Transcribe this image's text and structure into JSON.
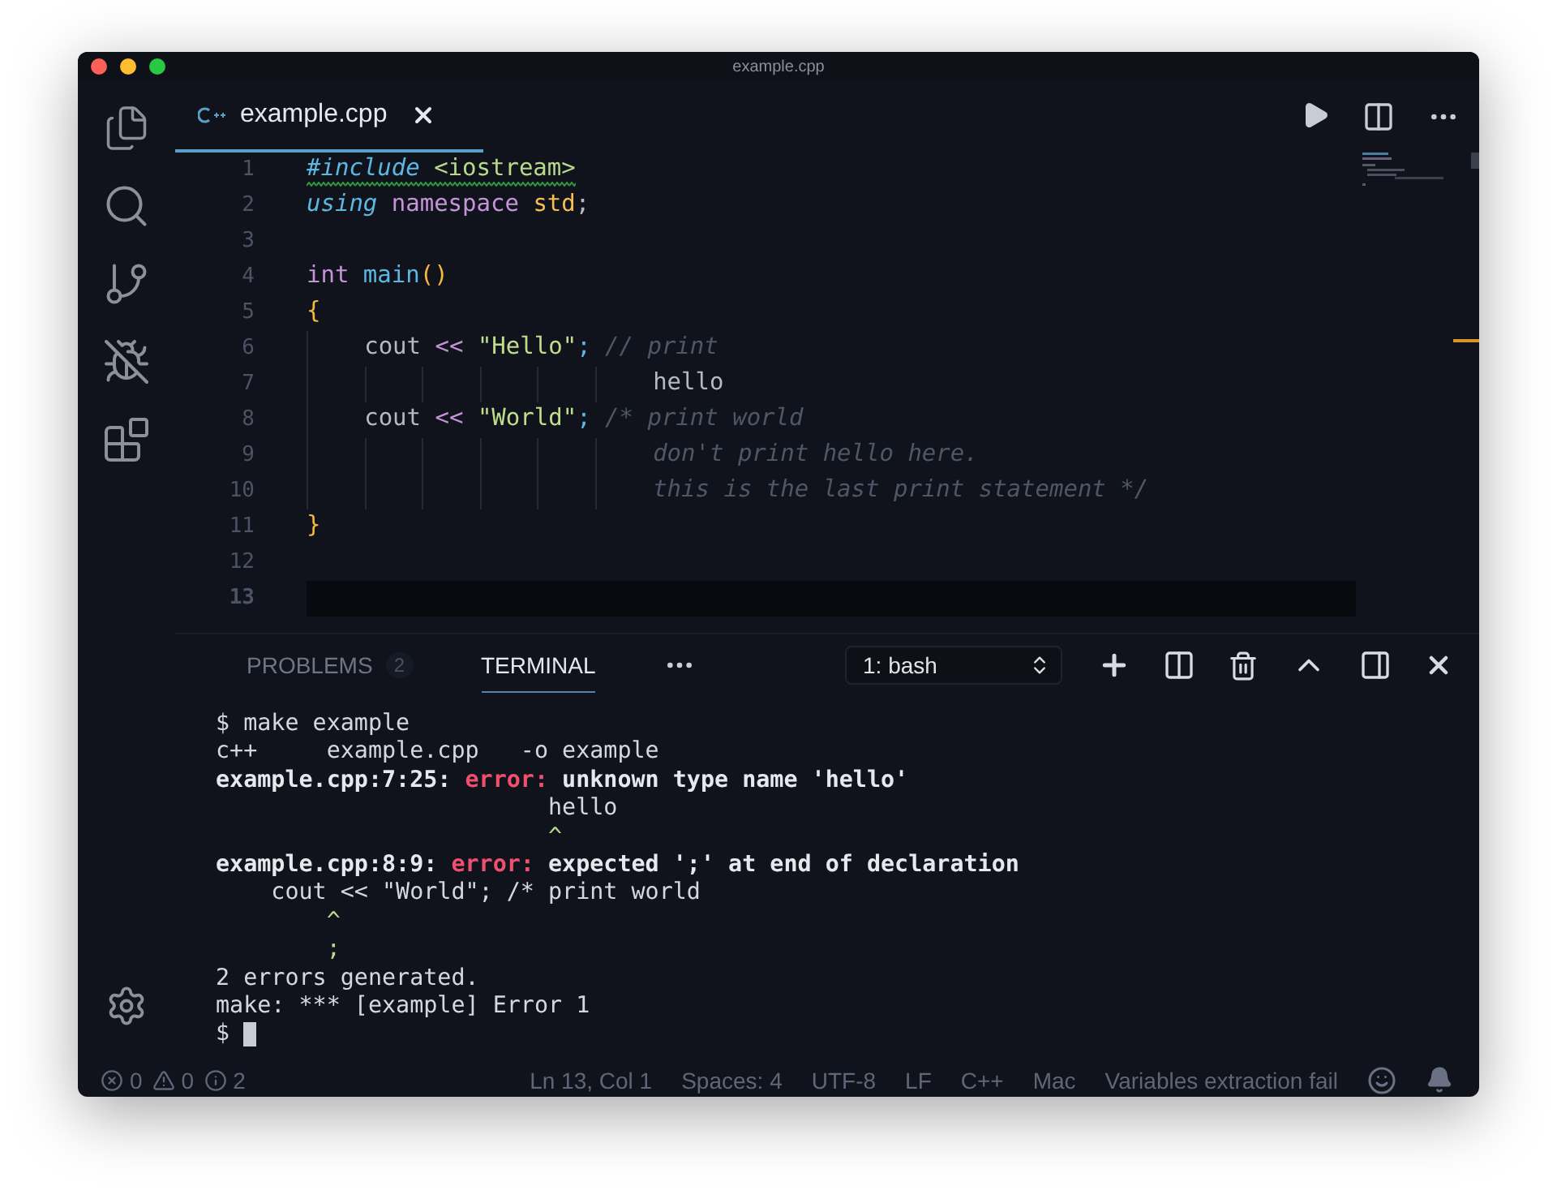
{
  "window": {
    "title": "example.cpp"
  },
  "editor_tab": {
    "label": "example.cpp",
    "selected": true
  },
  "code_lines": [
    {
      "number": "1",
      "squiggle": true,
      "current": false,
      "kind": "plain",
      "tokens": [
        {
          "text": "#include ",
          "kind": "directive"
        },
        {
          "text": "<iostream>",
          "kind": "header"
        }
      ]
    },
    {
      "number": "2",
      "squiggle": false,
      "current": false,
      "kind": "plain",
      "tokens": [
        {
          "text": "using ",
          "kind": "storage"
        },
        {
          "text": "namespace ",
          "kind": "keyword"
        },
        {
          "text": "std",
          "kind": "entity"
        },
        {
          "text": ";",
          "kind": "plain"
        }
      ]
    },
    {
      "number": "3",
      "current": false,
      "kind": "plain"
    },
    {
      "number": "4",
      "squiggle": false,
      "current": false,
      "kind": "plain",
      "tokens": [
        {
          "text": "int ",
          "kind": "keyword"
        },
        {
          "text": "main",
          "kind": "function"
        },
        {
          "text": "()",
          "kind": "bracket"
        }
      ]
    },
    {
      "number": "5",
      "squiggle": false,
      "current": false,
      "kind": "plain",
      "tokens": [
        {
          "text": "{",
          "kind": "bracket"
        }
      ]
    },
    {
      "number": "6",
      "squiggle": false,
      "current": false,
      "kind": "block",
      "tokens": [
        {
          "text": "cout ",
          "kind": "plain"
        },
        {
          "text": "<< ",
          "kind": "operator"
        },
        {
          "text": "\"Hello\"",
          "kind": "string"
        },
        {
          "text": ";",
          "kind": "terminator"
        },
        {
          "text": " // print",
          "kind": "comment"
        }
      ]
    },
    {
      "number": "7",
      "squiggle": false,
      "current": false,
      "kind": "continuation",
      "tokens": [
        {
          "text": "hello",
          "kind": "plain"
        }
      ]
    },
    {
      "number": "8",
      "squiggle": false,
      "current": false,
      "kind": "block",
      "tokens": [
        {
          "text": "cout ",
          "kind": "plain"
        },
        {
          "text": "<< ",
          "kind": "operator"
        },
        {
          "text": "\"World\"",
          "kind": "string"
        },
        {
          "text": ";",
          "kind": "terminator"
        },
        {
          "text": " /* print world",
          "kind": "comment"
        }
      ]
    },
    {
      "number": "9",
      "squiggle": false,
      "current": false,
      "kind": "continuation",
      "tokens": [
        {
          "text": "don't print hello here.",
          "kind": "comment"
        }
      ]
    },
    {
      "number": "10",
      "squiggle": false,
      "current": false,
      "kind": "continuation",
      "tokens": [
        {
          "text": "this is the last print statement */",
          "kind": "comment"
        }
      ]
    },
    {
      "number": "11",
      "squiggle": false,
      "current": false,
      "kind": "plain",
      "tokens": [
        {
          "text": "}",
          "kind": "bracket"
        }
      ]
    },
    {
      "number": "12",
      "current": false,
      "kind": "plain"
    },
    {
      "number": "13",
      "current": true,
      "kind": "plain"
    }
  ],
  "panel": {
    "tabs": [
      {
        "label": "PROBLEMS",
        "badge": "2",
        "selected": false
      },
      {
        "label": "TERMINAL",
        "selected": true
      }
    ],
    "terminal_select": "1: bash"
  },
  "terminal_lines": [
    [
      {
        "text": "$ make example",
        "kind": "plain"
      }
    ],
    [
      {
        "text": "c++     example.cpp   -o example",
        "kind": "plain"
      }
    ],
    [
      {
        "text": "example.cpp:7:25: ",
        "kind": "bold"
      },
      {
        "text": "error:",
        "kind": "error"
      },
      {
        "text": " unknown type name 'hello'",
        "kind": "bold"
      }
    ],
    [
      {
        "text": "                        hello",
        "kind": "plain"
      }
    ],
    [
      {
        "text": "                        ^",
        "kind": "caret"
      }
    ],
    [
      {
        "text": "example.cpp:8:9: ",
        "kind": "bold"
      },
      {
        "text": "error:",
        "kind": "error"
      },
      {
        "text": " expected ';' at end of declaration",
        "kind": "bold"
      }
    ],
    [
      {
        "text": "    cout << \"World\"; /* print world",
        "kind": "plain"
      }
    ],
    [
      {
        "text": "        ^",
        "kind": "caret"
      }
    ],
    [
      {
        "text": "        ;",
        "kind": "caret"
      }
    ],
    [
      {
        "text": "2 errors generated.",
        "kind": "plain"
      }
    ],
    [
      {
        "text": "make: *** [example] Error 1",
        "kind": "plain"
      }
    ],
    [
      {
        "text": "$ ",
        "kind": "plain"
      },
      {
        "kind": "cursor"
      }
    ]
  ],
  "status_bar": {
    "problems": [
      {
        "kind": "error",
        "count": "0"
      },
      {
        "kind": "warning",
        "count": "0"
      },
      {
        "kind": "info",
        "count": "2"
      }
    ],
    "items": [
      "Ln 13, Col 1",
      "Spaces: 4",
      "UTF-8",
      "LF",
      "C++",
      "Mac",
      "Variables extraction fail"
    ]
  }
}
